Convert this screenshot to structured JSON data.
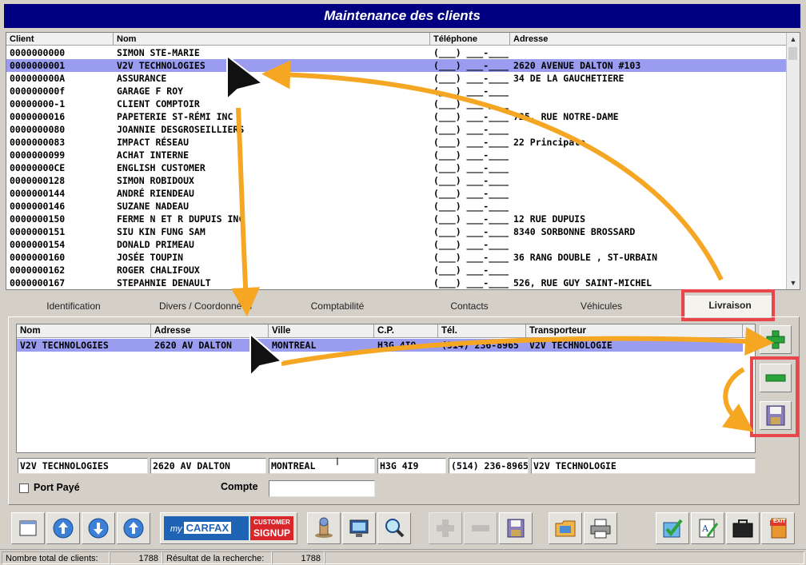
{
  "window": {
    "title": "Maintenance des clients"
  },
  "clients": {
    "columns": [
      "Client",
      "Nom",
      "Téléphone",
      "Adresse"
    ],
    "rows": [
      [
        "0000000000",
        "SIMON STE-MARIE",
        "(___) ___-____",
        ""
      ],
      [
        "0000000001",
        "V2V TECHNOLOGIES",
        "(___) ___-____",
        "2620 AVENUE DALTON #103"
      ],
      [
        "000000000A",
        "ASSURANCE",
        "(___) ___-____",
        "34 DE LA GAUCHETIERE"
      ],
      [
        "000000000f",
        "GARAGE F ROY",
        "(___) ___-____",
        ""
      ],
      [
        "00000000-1",
        "CLIENT COMPTOIR",
        "(___) ___-____",
        ""
      ],
      [
        "0000000016",
        "PAPETERIE ST-RÉMI INC",
        "(___) ___-____",
        "725, RUE NOTRE-DAME"
      ],
      [
        "0000000080",
        "JOANNIE DESGROSEILLIERS",
        "(___) ___-____",
        ""
      ],
      [
        "0000000083",
        "IMPACT RÉSEAU",
        "(___) ___-____",
        "22  Principale"
      ],
      [
        "0000000099",
        "ACHAT INTERNE",
        "(___) ___-____",
        ""
      ],
      [
        "00000000CE",
        "ENGLISH CUSTOMER",
        "(___) ___-____",
        ""
      ],
      [
        "0000000128",
        "SIMON ROBIDOUX",
        "(___) ___-____",
        ""
      ],
      [
        "0000000144",
        "ANDRÉ RIENDEAU",
        "(___) ___-____",
        ""
      ],
      [
        "0000000146",
        "SUZANE NADEAU",
        "(___) ___-____",
        ""
      ],
      [
        "0000000150",
        "FERME N ET R DUPUIS INC",
        "(___) ___-____",
        "12 RUE DUPUIS"
      ],
      [
        "0000000151",
        "SIU KIN FUNG SAM",
        "(___) ___-____",
        "8340 SORBONNE BROSSARD"
      ],
      [
        "0000000154",
        "DONALD PRIMEAU",
        "(___) ___-____",
        ""
      ],
      [
        "0000000160",
        "JOSÉE TOUPIN",
        "(___) ___-____",
        "36 RANG DOUBLE , ST-URBAIN"
      ],
      [
        "0000000162",
        "ROGER CHALIFOUX",
        "(___) ___-____",
        ""
      ],
      [
        "0000000167",
        "STEPAHNIE DENAULT",
        "(___) ___-____",
        "526, RUE GUY SAINT-MICHEL"
      ]
    ],
    "selected_index": 1
  },
  "tabs": [
    "Identification",
    "Divers / Coordonnées",
    "Comptabilité",
    "Contacts",
    "Véhicules",
    "Livraison"
  ],
  "active_tab": "Livraison",
  "shipping": {
    "columns": [
      "Nom",
      "Adresse",
      "Ville",
      "C.P.",
      "Tél.",
      "Transporteur"
    ],
    "row": [
      "V2V TECHNOLOGIES",
      "2620 AV DALTON",
      "MONTREAL",
      "H3G 4I9",
      "(514) 236-8965",
      "V2V TECHNOLOGIE"
    ],
    "fields": {
      "nom": "V2V TECHNOLOGIES",
      "adresse": "2620 AV DALTON",
      "ville": "MONTREAL",
      "cp": "H3G 4I9",
      "tel": "(514) 236-8965",
      "transporteur": "V2V TECHNOLOGIE",
      "compte": ""
    },
    "port_paye_label": "Port Payé",
    "compte_label": "Compte"
  },
  "carfax": {
    "my": "my",
    "brand": "CARFAX",
    "signup_line1": "CUSTOMER",
    "signup_line2": "SIGNUP"
  },
  "exit_label": "EXIT",
  "status": {
    "total_label": "Nombre total de clients:",
    "total_value": "1788",
    "search_label": "Résultat de la recherche:",
    "search_value": "1788"
  },
  "colors": {
    "title_bar": "#000080",
    "selection": "#9a9cf0",
    "annotation_arrow": "#f5a623",
    "highlight_box": "#e8464b"
  }
}
